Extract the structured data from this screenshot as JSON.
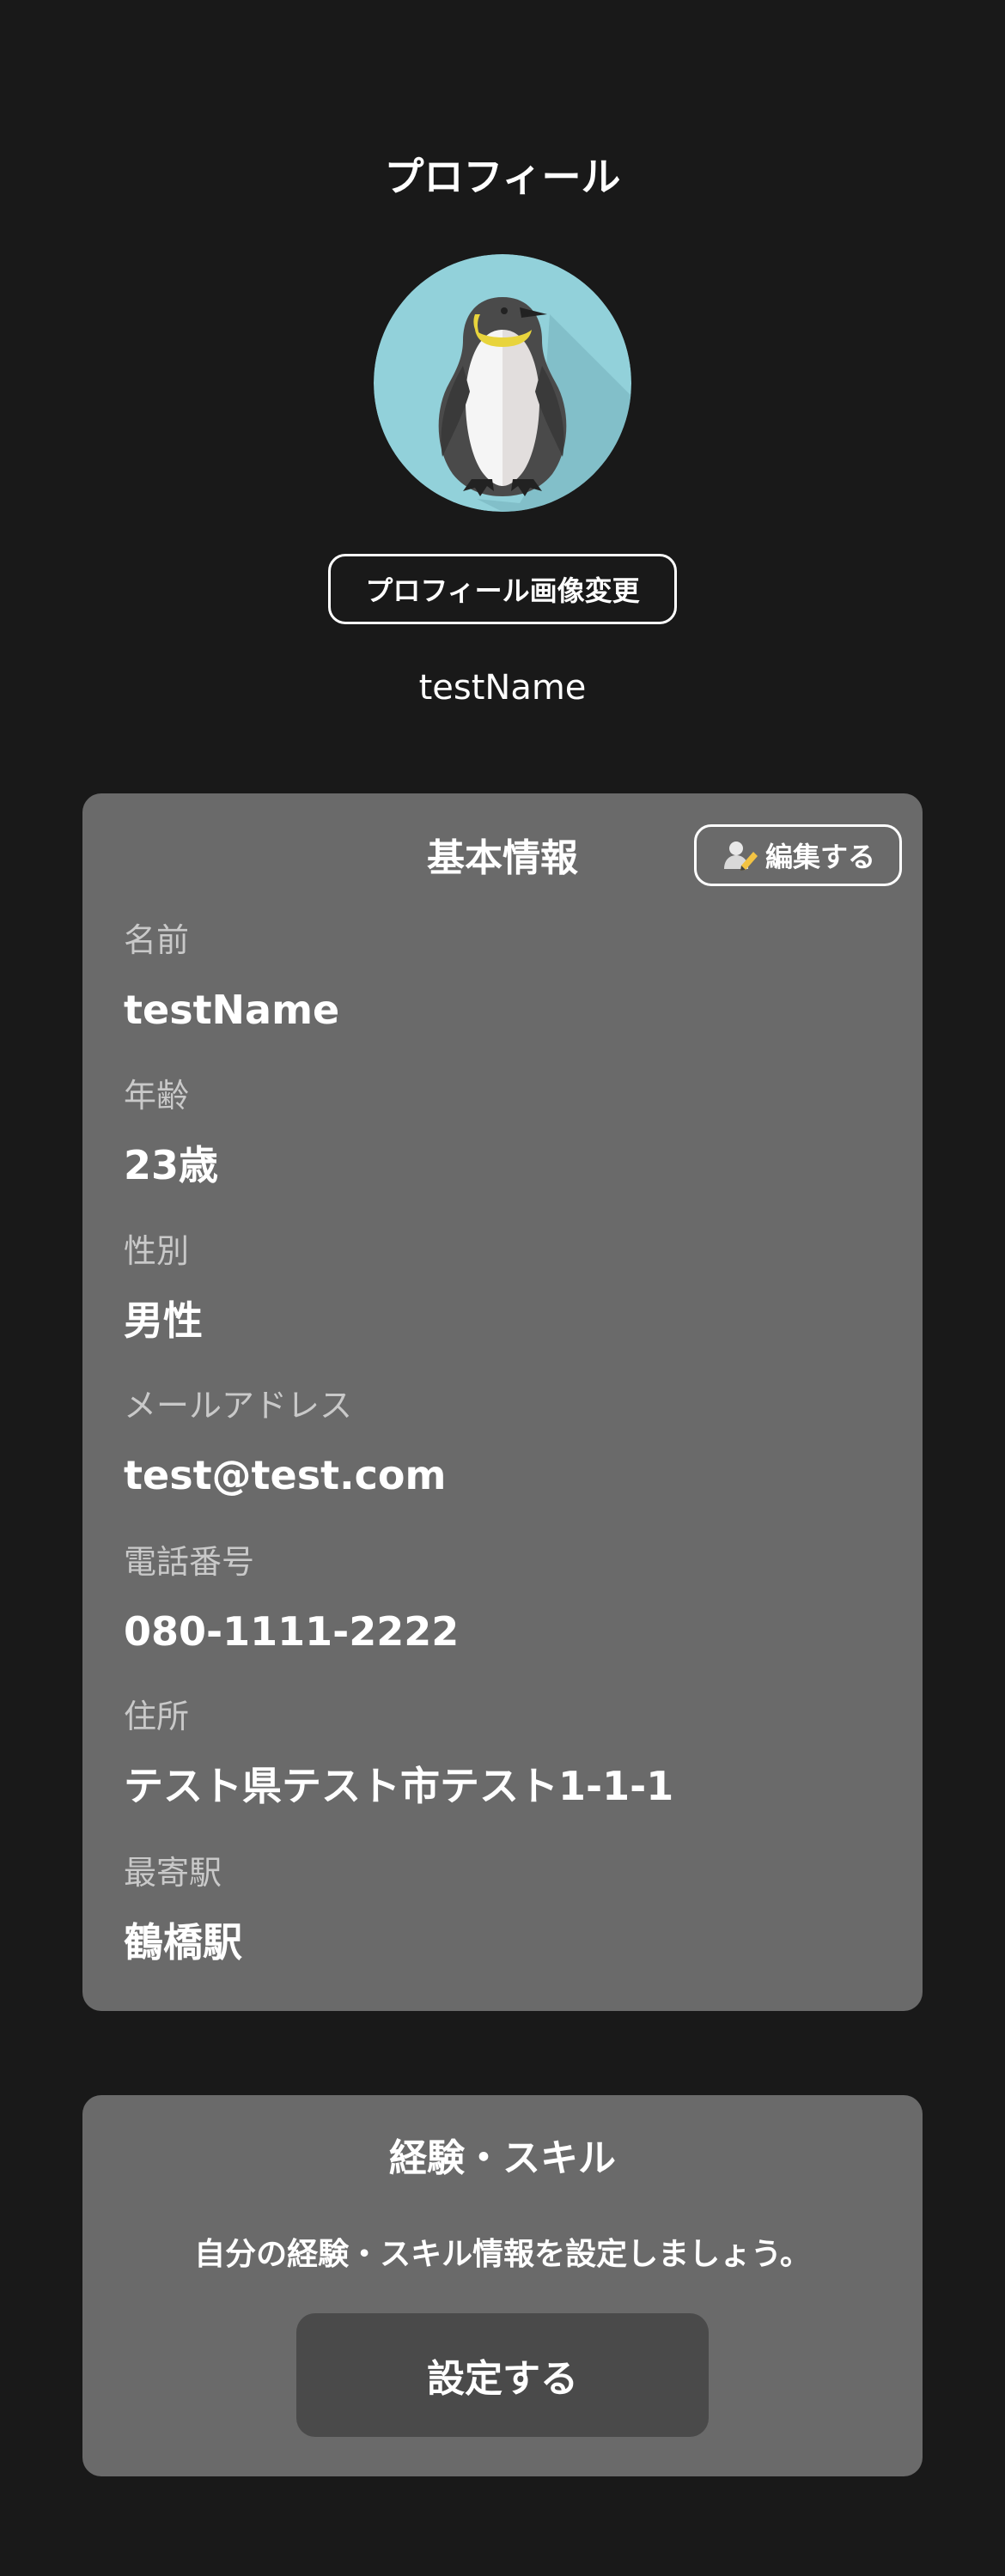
{
  "header": {
    "title": "プロフィール"
  },
  "profile": {
    "avatar_icon": "penguin-avatar",
    "change_photo_label": "プロフィール画像変更",
    "display_name": "testName"
  },
  "basic_info": {
    "title": "基本情報",
    "edit_label": "編集する",
    "edit_icon": "user-edit-icon",
    "fields": [
      {
        "label": "名前",
        "value": "testName"
      },
      {
        "label": "年齢",
        "value": "23歳"
      },
      {
        "label": "性別",
        "value": "男性"
      },
      {
        "label": "メールアドレス",
        "value": "test@test.com"
      },
      {
        "label": "電話番号",
        "value": "080-1111-2222"
      },
      {
        "label": "住所",
        "value": "テスト県テスト市テスト1-1-1"
      },
      {
        "label": "最寄駅",
        "value": "鶴橋駅"
      }
    ]
  },
  "skills": {
    "title": "経験・スキル",
    "description": "自分の経験・スキル情報を設定しましょう。",
    "setup_label": "設定する"
  },
  "colors": {
    "background": "#191919",
    "card": "#6a6a6a",
    "button_dark": "#4a4a4a",
    "avatar_bg": "#92d1da"
  }
}
